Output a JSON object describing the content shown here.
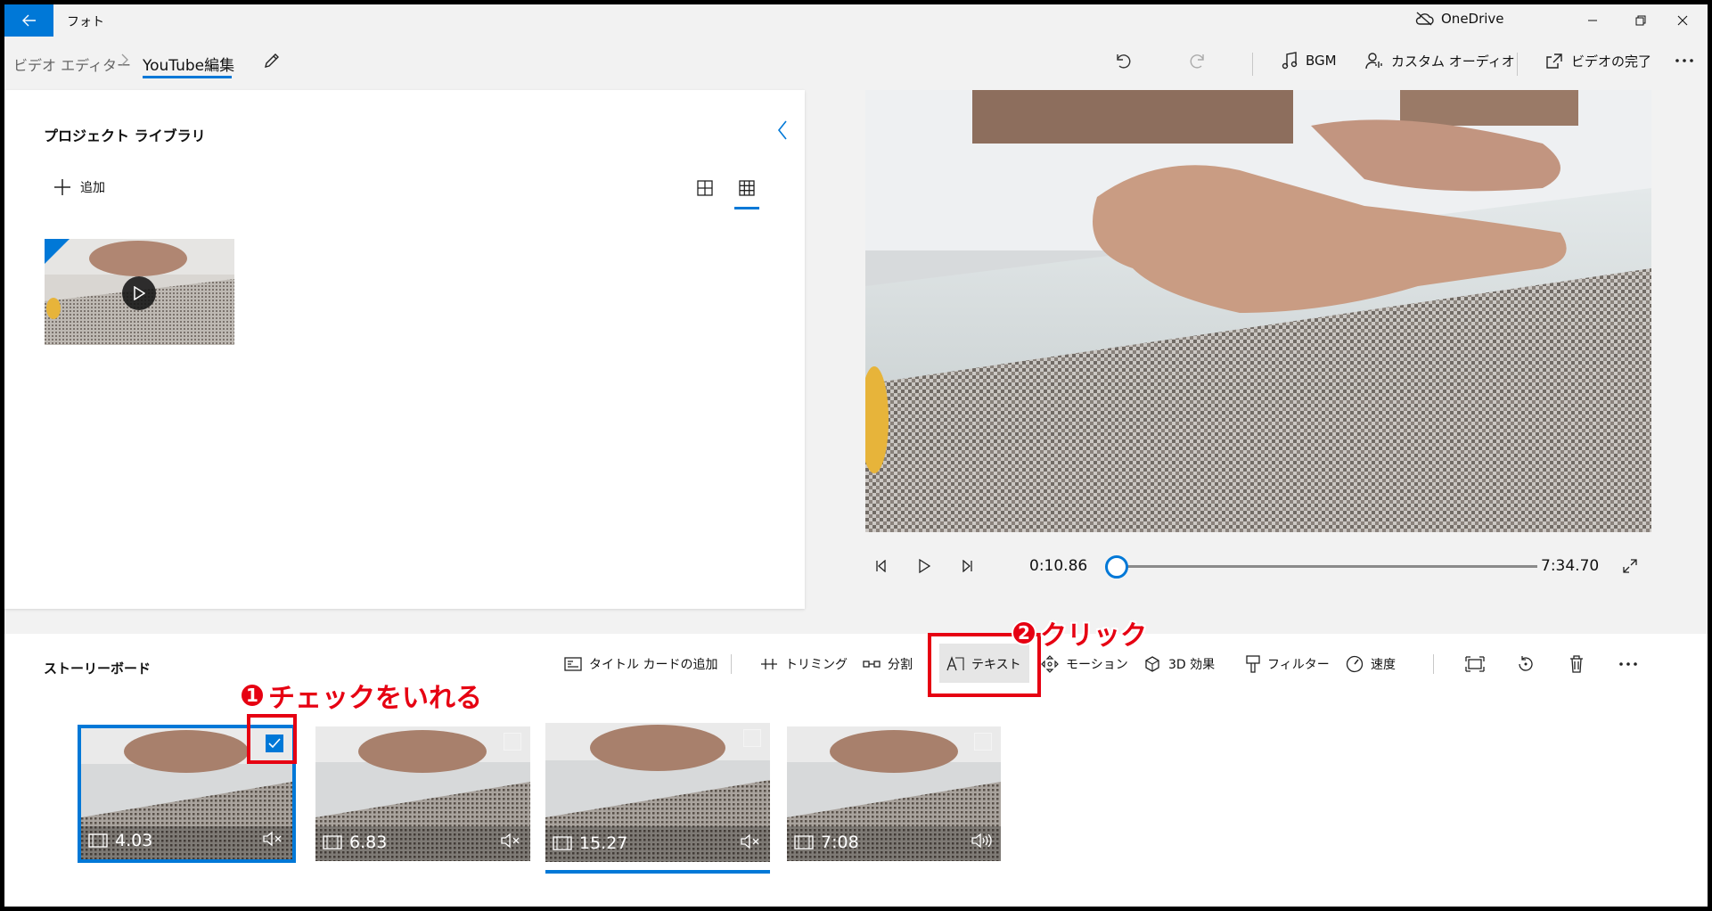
{
  "titlebar": {
    "app_title": "フォト",
    "onedrive_label": "OneDrive"
  },
  "breadcrumb": {
    "parent": "ビデオ エディター",
    "current": "YouTube編集"
  },
  "toolbar": {
    "bgm_label": "BGM",
    "custom_audio_label": "カスタム オーディオ",
    "finish_video_label": "ビデオの完了"
  },
  "library": {
    "title": "プロジェクト ライブラリ",
    "add_label": "追加"
  },
  "player": {
    "current_time": "0:10.86",
    "total_time": "7:34.70",
    "progress": 0.024
  },
  "storyboard": {
    "title": "ストーリーボード",
    "tools": {
      "title_card": "タイトル カードの追加",
      "trim": "トリミング",
      "split": "分割",
      "text": "テキスト",
      "motion": "モーション",
      "effects3d": "3D 効果",
      "filters": "フィルター",
      "speed": "速度"
    },
    "clips": [
      {
        "duration": "4.03",
        "checked": true,
        "audio": "muted"
      },
      {
        "duration": "6.83",
        "checked": false,
        "audio": "muted"
      },
      {
        "duration": "15.27",
        "checked": false,
        "audio": "muted"
      },
      {
        "duration": "7:08",
        "checked": false,
        "audio": "on"
      }
    ]
  },
  "annotations": {
    "step1_number": "1",
    "step1_text": "チェックをいれる",
    "step2_number": "2",
    "step2_text": "クリック"
  },
  "colors": {
    "accent": "#0078d7",
    "annotation": "#e60012"
  }
}
